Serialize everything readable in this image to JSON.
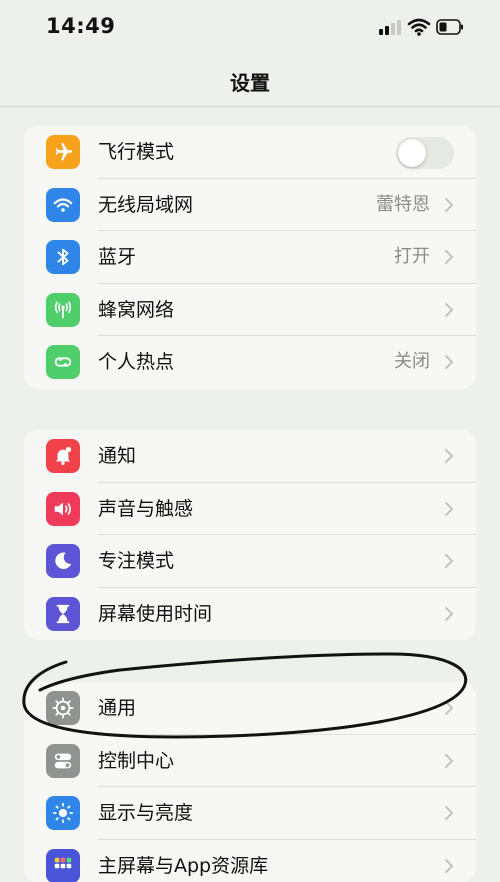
{
  "status_bar": {
    "time": "14:49"
  },
  "nav": {
    "title": "设置"
  },
  "groups": [
    {
      "rows": [
        {
          "label": "飞行模式",
          "value": "",
          "toggle": false,
          "icon": "airplane-icon",
          "color": "#f6a21a"
        },
        {
          "label": "无线局域网",
          "value": "蕾特恩",
          "icon": "wifi-icon",
          "color": "#2f86e8"
        },
        {
          "label": "蓝牙",
          "value": "打开",
          "icon": "bluetooth-icon",
          "color": "#2f86e8"
        },
        {
          "label": "蜂窝网络",
          "value": "",
          "icon": "antenna-icon",
          "color": "#4fce6b"
        },
        {
          "label": "个人热点",
          "value": "关闭",
          "icon": "hotspot-icon",
          "color": "#4fce6b"
        }
      ]
    },
    {
      "rows": [
        {
          "label": "通知",
          "value": "",
          "icon": "bell-icon",
          "color": "#f1424a"
        },
        {
          "label": "声音与触感",
          "value": "",
          "icon": "speaker-icon",
          "color": "#f03a5a"
        },
        {
          "label": "专注模式",
          "value": "",
          "icon": "moon-icon",
          "color": "#5e55d6"
        },
        {
          "label": "屏幕使用时间",
          "value": "",
          "icon": "hourglass-icon",
          "color": "#5e55d6"
        }
      ]
    },
    {
      "rows": [
        {
          "label": "通用",
          "value": "",
          "icon": "gear-icon",
          "color": "#909490"
        },
        {
          "label": "控制中心",
          "value": "",
          "icon": "switches-icon",
          "color": "#909490"
        },
        {
          "label": "显示与亮度",
          "value": "",
          "icon": "sun-icon",
          "color": "#2f86e8"
        },
        {
          "label": "主屏幕与App资源库",
          "value": "",
          "icon": "grid-icon",
          "color": "#4a54d8"
        }
      ]
    }
  ]
}
